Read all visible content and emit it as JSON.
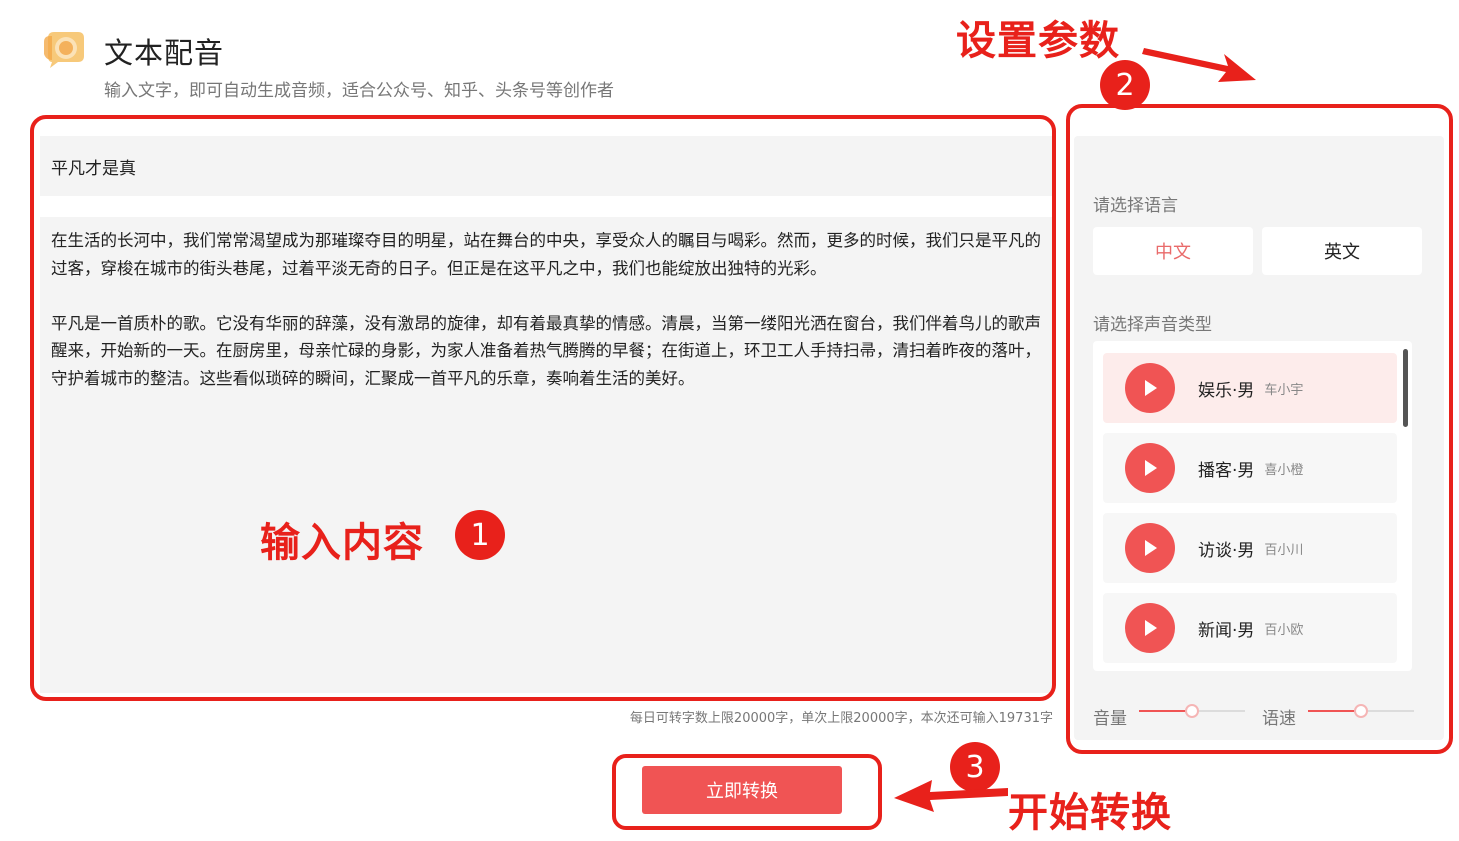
{
  "header": {
    "title": "文本配音",
    "subtitle": "输入文字，即可自动生成音频，适合公众号、知乎、头条号等创作者",
    "logo_icon": "speech-bubble-logo-icon"
  },
  "editor": {
    "title_value": "平凡才是真",
    "paragraphs": [
      "在生活的长河中，我们常常渴望成为那璀璨夺目的明星，站在舞台的中央，享受众人的瞩目与喝彩。然而，更多的时候，我们只是平凡的过客，穿梭在城市的街头巷尾，过着平淡无奇的日子。但正是在这平凡之中，我们也能绽放出独特的光彩。",
      "平凡是一首质朴的歌。它没有华丽的辞藻，没有激昂的旋律，却有着最真挚的情感。清晨，当第一缕阳光洒在窗台，我们伴着鸟儿的歌声醒来，开始新的一天。在厨房里，母亲忙碌的身影，为家人准备着热气腾腾的早餐；在街道上，环卫工人手持扫帚，清扫着昨夜的落叶，守护着城市的整洁。这些看似琐碎的瞬间，汇聚成一首平凡的乐章，奏响着生活的美好。"
    ],
    "counter": "每日可转字数上限20000字，单次上限20000字，本次还可输入19731字"
  },
  "settings": {
    "language_label": "请选择语言",
    "languages": [
      {
        "label": "中文",
        "selected": true
      },
      {
        "label": "英文",
        "selected": false
      }
    ],
    "voice_label": "请选择声音类型",
    "voices": [
      {
        "name": "娱乐·男",
        "speaker": "车小宇",
        "selected": true
      },
      {
        "name": "播客·男",
        "speaker": "喜小橙",
        "selected": false
      },
      {
        "name": "访谈·男",
        "speaker": "百小川",
        "selected": false
      },
      {
        "name": "新闻·男",
        "speaker": "百小欧",
        "selected": false
      }
    ],
    "volume_label": "音量",
    "volume_level": 0.5,
    "speed_label": "语速",
    "speed_level": 0.5
  },
  "convert_button": "立即转换",
  "annotations": {
    "step1_text": "输入内容",
    "step1_num": "1",
    "step2_text": "设置参数",
    "step2_num": "2",
    "step3_text": "开始转换",
    "step3_num": "3"
  },
  "colors": {
    "accent": "#f05454",
    "annotation": "#e8211b",
    "selected_bg": "#fdeceb"
  }
}
